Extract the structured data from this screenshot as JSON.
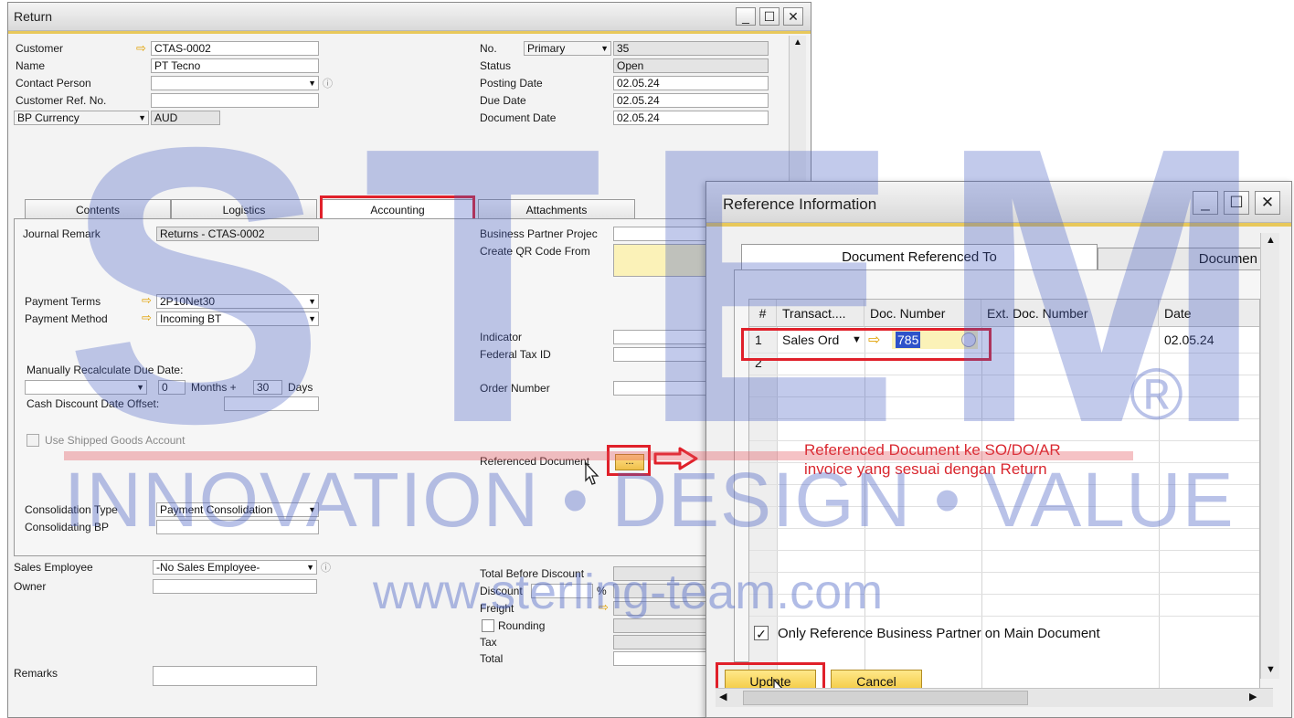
{
  "return_window": {
    "title": "Return",
    "header_left": {
      "customer_label": "Customer",
      "customer_value": "CTAS-0002",
      "name_label": "Name",
      "name_value": "PT Tecno",
      "contact_person_label": "Contact Person",
      "customer_ref_label": "Customer Ref. No.",
      "bp_currency_label": "BP Currency",
      "bp_currency_value": "AUD"
    },
    "header_right": {
      "no_label": "No.",
      "no_series": "Primary",
      "no_value": "35",
      "status_label": "Status",
      "status_value": "Open",
      "posting_date_label": "Posting Date",
      "posting_date_value": "02.05.24",
      "due_date_label": "Due Date",
      "due_date_value": "02.05.24",
      "document_date_label": "Document Date",
      "document_date_value": "02.05.24"
    },
    "tabs": [
      "Contents",
      "Logistics",
      "Accounting",
      "Attachments"
    ],
    "accounting": {
      "journal_remark_label": "Journal Remark",
      "journal_remark_value": "Returns - CTAS-0002",
      "payment_terms_label": "Payment Terms",
      "payment_terms_value": "2P10Net30",
      "payment_method_label": "Payment Method",
      "payment_method_value": "Incoming BT",
      "manual_recalc_label": "Manually Recalculate Due Date:",
      "months_value": "0",
      "months_label": "Months +",
      "days_value": "30",
      "days_label": "Days",
      "cash_discount_label": "Cash Discount Date Offset:",
      "use_shipped_goods_label": "Use Shipped Goods Account",
      "consolidation_type_label": "Consolidation Type",
      "consolidation_type_value": "Payment Consolidation",
      "consolidating_bp_label": "Consolidating BP",
      "bp_project_label": "Business Partner Projec",
      "create_qr_label": "Create QR Code From",
      "indicator_label": "Indicator",
      "federal_tax_label": "Federal Tax ID",
      "order_number_label": "Order Number",
      "referenced_document_label": "Referenced Document",
      "referenced_document_button": "..."
    },
    "footer": {
      "sales_employee_label": "Sales Employee",
      "sales_employee_value": "-No Sales Employee-",
      "owner_label": "Owner",
      "remarks_label": "Remarks",
      "total_before_discount_label": "Total Before Discount",
      "discount_label": "Discount",
      "discount_unit": "%",
      "freight_label": "Freight",
      "rounding_label": "Rounding",
      "tax_label": "Tax",
      "total_label": "Total"
    }
  },
  "reference_window": {
    "title": "Reference Information",
    "tabs": [
      "Document Referenced To",
      "Documen"
    ],
    "columns": [
      "#",
      "Transact....",
      "Doc. Number",
      "Ext. Doc. Number",
      "Date"
    ],
    "rows": [
      {
        "num": "1",
        "transaction": "Sales Ord",
        "doc_number": "785",
        "ext_doc_number": "",
        "date": "02.05.24"
      },
      {
        "num": "2",
        "transaction": "",
        "doc_number": "",
        "ext_doc_number": "",
        "date": ""
      }
    ],
    "only_reference_label": "Only Reference Business Partner on Main Document",
    "update_button": "Update",
    "cancel_button": "Cancel"
  },
  "annotation": {
    "line1": "Referenced Document ke SO/DO/AR",
    "line2": "invoice yang sesuai dengan Return",
    "color": "#d9262e"
  },
  "watermark": {
    "brand": "STEM",
    "registered": "®",
    "tagline": "INNOVATION • DESIGN • VALUE",
    "url": "www.sterling-team.com"
  },
  "colors": {
    "highlight_red": "#e0202a",
    "field_yellow": "#fbf2b8",
    "button_gold": "#f2c83c"
  }
}
